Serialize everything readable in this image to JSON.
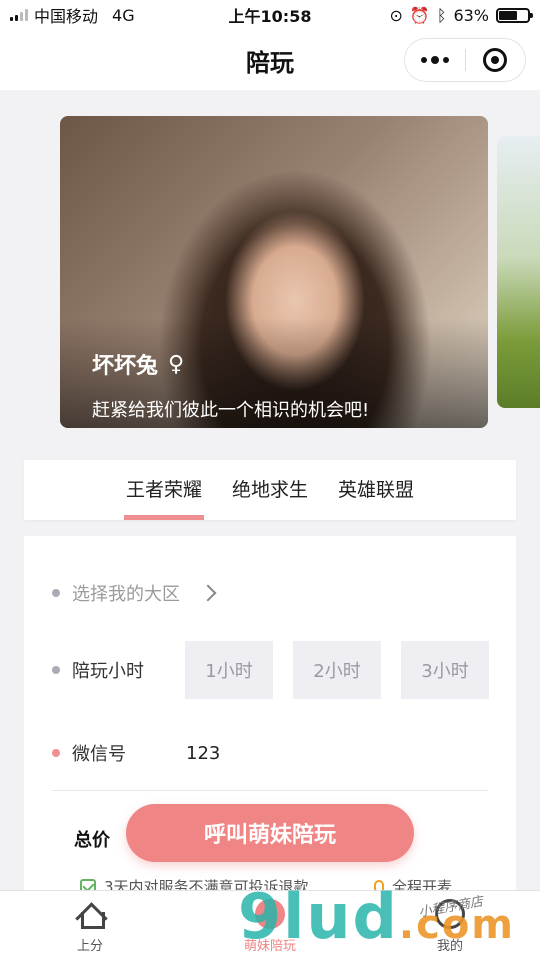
{
  "status_bar": {
    "carrier": "中国移动",
    "network": "4G",
    "time": "上午10:58",
    "battery_percent": "63%",
    "battery_level": 0.63
  },
  "nav": {
    "title": "陪玩"
  },
  "banner": {
    "name": "坏坏兔",
    "gender_icon": "female-icon",
    "slogan": "赶紧给我们彼此一个相识的机会吧!"
  },
  "game_tabs": [
    {
      "label": "王者荣耀",
      "active": true
    },
    {
      "label": "绝地求生",
      "active": false
    },
    {
      "label": "英雄联盟",
      "active": false
    }
  ],
  "form": {
    "region_placeholder": "选择我的大区",
    "hours_label": "陪玩小时",
    "hour_options": [
      "1小时",
      "2小时",
      "3小时"
    ],
    "wechat_label": "微信号",
    "wechat_value": "123",
    "total_label": "总价",
    "guarantee_text": "3天内对服务不满意可投诉退款",
    "mic_text": "全程开麦"
  },
  "cta": {
    "label": "呼叫萌妹陪玩"
  },
  "tab_bar": [
    {
      "label": "上分",
      "icon": "home-icon"
    },
    {
      "label": "萌妹陪玩",
      "icon": "girl-icon"
    },
    {
      "label": "我的",
      "icon": "user-icon"
    }
  ],
  "watermark": {
    "text": "9lud",
    "suffix": ".com",
    "script": "小程序商店"
  },
  "colors": {
    "accent": "#ef8585",
    "tab_underline": "#ef8f8f",
    "dot_gray": "#a9abb4"
  }
}
